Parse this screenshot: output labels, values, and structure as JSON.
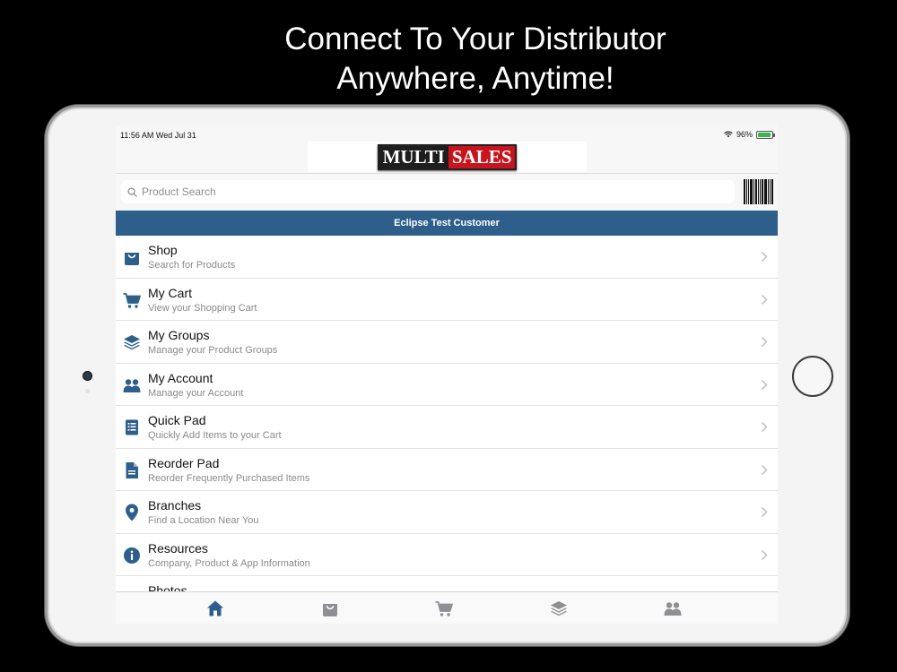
{
  "headline": {
    "line1": "Connect To Your Distributor",
    "line2": "Anywhere, Anytime!"
  },
  "status_bar": {
    "time_date": "11:56 AM   Wed Jul 31",
    "battery": "96%",
    "battery_level": 0.96
  },
  "logo": {
    "part1": "MULTI",
    "part2": "SALES"
  },
  "search": {
    "placeholder": "Product Search",
    "value": ""
  },
  "customer": {
    "name": "Eclipse Test Customer"
  },
  "menu": {
    "items": [
      {
        "title": "Shop",
        "subtitle": "Search for Products",
        "icon": "shopping-bag-icon"
      },
      {
        "title": "My Cart",
        "subtitle": "View your Shopping Cart",
        "icon": "cart-icon"
      },
      {
        "title": "My Groups",
        "subtitle": "Manage your Product Groups",
        "icon": "layers-icon"
      },
      {
        "title": "My Account",
        "subtitle": "Manage your Account",
        "icon": "users-icon"
      },
      {
        "title": "Quick Pad",
        "subtitle": "Quickly Add Items to your Cart",
        "icon": "list-icon"
      },
      {
        "title": "Reorder Pad",
        "subtitle": "Reorder Frequently Purchased Items",
        "icon": "document-icon"
      },
      {
        "title": "Branches",
        "subtitle": "Find a Location Near You",
        "icon": "map-pin-icon"
      },
      {
        "title": "Resources",
        "subtitle": "Company, Product & App Information",
        "icon": "info-icon"
      },
      {
        "title": "Photos",
        "subtitle": "",
        "icon": "photo-icon"
      }
    ]
  },
  "tabs": [
    "home-icon",
    "shopping-bag-icon",
    "cart-icon",
    "layers-icon",
    "users-icon"
  ],
  "colors": {
    "accent": "#2d5f8a",
    "icon": "#2d5f8a",
    "tab_inactive": "#8e8e93",
    "brand_red": "#c8141c"
  }
}
